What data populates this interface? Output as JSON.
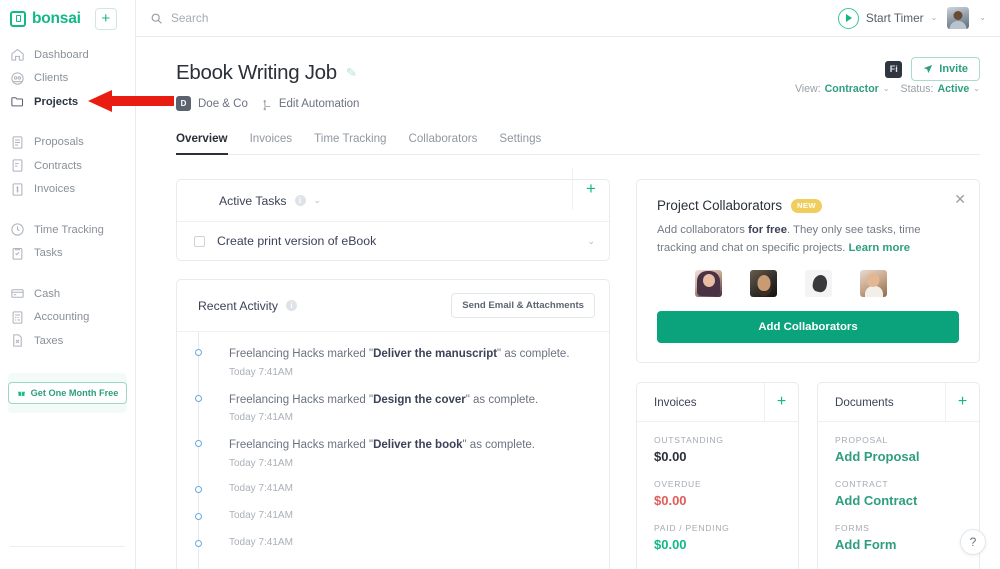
{
  "sidebar": {
    "logo_text": "bonsai",
    "add_label": "+",
    "groups": [
      {
        "items": [
          {
            "label": "Dashboard",
            "icon": "home-icon",
            "active": false
          },
          {
            "label": "Clients",
            "icon": "clients-icon",
            "active": false
          },
          {
            "label": "Projects",
            "icon": "folder-icon",
            "active": true
          }
        ]
      },
      {
        "items": [
          {
            "label": "Proposals",
            "icon": "proposal-icon",
            "active": false
          },
          {
            "label": "Contracts",
            "icon": "contract-icon",
            "active": false
          },
          {
            "label": "Invoices",
            "icon": "invoice-icon",
            "active": false
          }
        ]
      },
      {
        "items": [
          {
            "label": "Time Tracking",
            "icon": "clock-icon",
            "active": false
          },
          {
            "label": "Tasks",
            "icon": "tasks-icon",
            "active": false
          }
        ]
      },
      {
        "items": [
          {
            "label": "Cash",
            "icon": "card-icon",
            "active": false
          },
          {
            "label": "Accounting",
            "icon": "accounting-icon",
            "active": false
          },
          {
            "label": "Taxes",
            "icon": "taxes-icon",
            "active": false
          }
        ]
      }
    ],
    "promo_label": "Get One Month Free"
  },
  "topbar": {
    "search_placeholder": "Search",
    "timer_label": "Start Timer",
    "timer_caret": "⌄",
    "avatar_caret": "⌄"
  },
  "project": {
    "title": "Ebook Writing Job",
    "client_initial": "D",
    "client_name": "Doe & Co",
    "automation_label": "Edit Automation",
    "app_badge": "Fi",
    "invite_label": "Invite",
    "view_label": "View:",
    "view_value": "Contractor",
    "status_label": "Status:",
    "status_value": "Active",
    "tabs": [
      {
        "label": "Overview",
        "active": true
      },
      {
        "label": "Invoices",
        "active": false
      },
      {
        "label": "Time Tracking",
        "active": false
      },
      {
        "label": "Collaborators",
        "active": false
      },
      {
        "label": "Settings",
        "active": false
      }
    ]
  },
  "active_tasks": {
    "title": "Active Tasks",
    "info": "i",
    "chevron": "⌄",
    "add": "+",
    "tasks": [
      {
        "name": "Create print version of eBook",
        "chevron": "⌄"
      }
    ]
  },
  "recent_activity": {
    "title": "Recent Activity",
    "info": "i",
    "send_button": "Send Email & Attachments",
    "items": [
      {
        "prefix": "Freelancing Hacks marked \"",
        "bold": "Deliver the manuscript",
        "suffix": "\" as complete.",
        "time": "Today 7:41AM"
      },
      {
        "prefix": "Freelancing Hacks marked \"",
        "bold": "Design the cover",
        "suffix": "\" as complete.",
        "time": "Today 7:41AM"
      },
      {
        "prefix": "Freelancing Hacks marked \"",
        "bold": "Deliver the book",
        "suffix": "\" as complete.",
        "time": "Today 7:41AM"
      },
      {
        "prefix": "",
        "bold": "",
        "suffix": "",
        "time": "Today 7:41AM"
      },
      {
        "prefix": "",
        "bold": "",
        "suffix": "",
        "time": "Today 7:41AM"
      },
      {
        "prefix": "",
        "bold": "",
        "suffix": "",
        "time": "Today 7:41AM"
      }
    ]
  },
  "collaborators": {
    "title": "Project Collaborators",
    "badge": "NEW",
    "desc_1": "Add collaborators ",
    "desc_bold": "for free",
    "desc_2": ". They only see tasks, time tracking and chat on specific projects. ",
    "learn_more": "Learn more",
    "button": "Add Collaborators",
    "close": "✕"
  },
  "invoices_card": {
    "title": "Invoices",
    "add": "+",
    "stats": [
      {
        "label": "OUTSTANDING",
        "value": "$0.00",
        "color": "dark"
      },
      {
        "label": "OVERDUE",
        "value": "$0.00",
        "color": "red"
      },
      {
        "label": "PAID / PENDING",
        "value": "$0.00",
        "color": "green"
      }
    ]
  },
  "documents_card": {
    "title": "Documents",
    "add": "+",
    "items": [
      {
        "label": "PROPOSAL",
        "link": "Add Proposal"
      },
      {
        "label": "CONTRACT",
        "link": "Add Contract"
      },
      {
        "label": "FORMS",
        "link": "Add Form"
      }
    ]
  },
  "help": {
    "label": "?"
  },
  "annotation": {
    "arrow_color": "#e81c10",
    "points_to": "Projects"
  }
}
